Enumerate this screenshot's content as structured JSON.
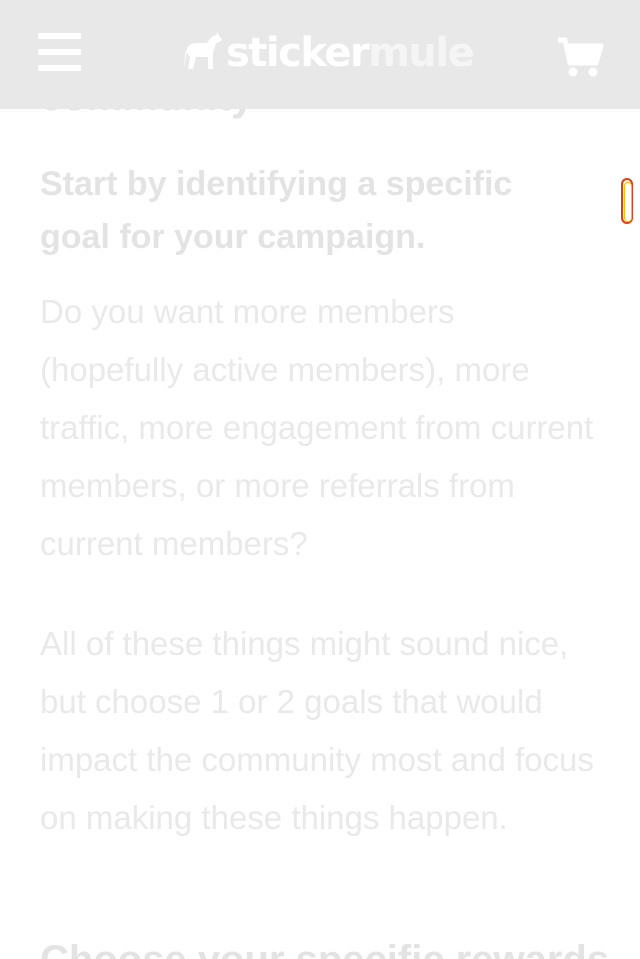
{
  "header": {
    "logo_part1": "sticker",
    "logo_part2": "mule",
    "menu_icon": "hamburger-menu-icon",
    "cart_icon": "shopping-cart-icon",
    "logo_icon": "mule-icon",
    "background": "#e8e8e8"
  },
  "article": {
    "partial_heading": "community",
    "lead": "Start by identifying a specific goal for your campaign.",
    "paragraphs": [
      "Do you want more members (hopefully active members), more traffic, more engagement from current members, or more referrals from current members?",
      "All of these things might sound nice, but choose 1 or 2 goals that would impact the community most and focus on making these things happen."
    ],
    "next_heading_partial": "Choose your specific rewards"
  }
}
